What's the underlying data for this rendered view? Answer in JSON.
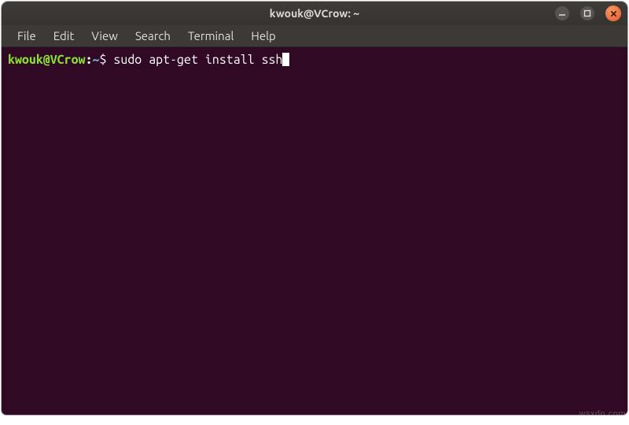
{
  "window": {
    "title": "kwouk@VCrow: ~"
  },
  "menubar": {
    "items": [
      {
        "label": "File"
      },
      {
        "label": "Edit"
      },
      {
        "label": "View"
      },
      {
        "label": "Search"
      },
      {
        "label": "Terminal"
      },
      {
        "label": "Help"
      }
    ]
  },
  "terminal": {
    "prompt": {
      "userhost": "kwouk@VCrow",
      "colon": ":",
      "path": "~",
      "symbol": "$ "
    },
    "command": "sudo apt-get install ssh"
  },
  "watermark": "wsxdn.com"
}
